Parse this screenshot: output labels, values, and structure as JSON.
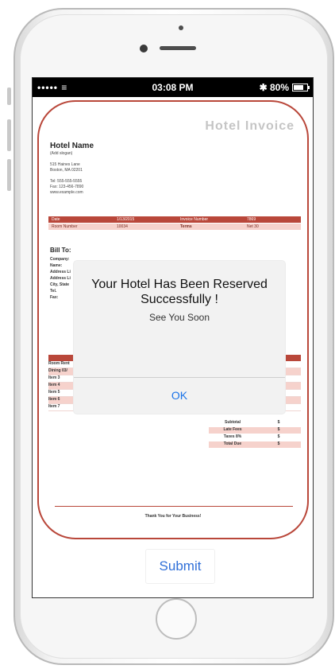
{
  "status_bar": {
    "signal": "••••• ≡",
    "time": "03:08 PM",
    "battery_text": "✱ 80%"
  },
  "invoice": {
    "title": "Hotel Invoice",
    "hotel_name": "Hotel Name",
    "slogan": "(Add slogan)",
    "address_line1": "515 Haines Lane",
    "address_line2": "Boston, MA 02201",
    "tel": "Tel: 555-555-5555",
    "fax": "Fax: 123-456-7890",
    "web": "www.example.com",
    "band1": {
      "date_label": "Date",
      "date_value": "1/13/2015",
      "invoice_label": "Invoice Number",
      "invoice_value": "7869"
    },
    "band2": {
      "room_label": "Room Number",
      "room_value": "10034",
      "terms_label": "Terms",
      "terms_value": "Net 30"
    },
    "bill_to": "Bill To:",
    "bill_lines": [
      "Company:",
      "Name:",
      "Address Li",
      "Address Li",
      "City, State",
      "Tel.",
      "Fax:"
    ],
    "item_rows": [
      "Room Rent",
      "Dining 03/",
      "Item 3",
      "Item 4",
      "Item 5",
      "Item 6",
      "Item 7"
    ],
    "totals": [
      {
        "label": "Subtotal",
        "value": "$"
      },
      {
        "label": "Late Fees",
        "value": "$"
      },
      {
        "label": "Taxes 8%",
        "value": "$"
      },
      {
        "label": "Total Due",
        "value": "$"
      }
    ],
    "thanks": "Thank You for Your Business!"
  },
  "dialog": {
    "title": "Your Hotel Has Been Reserved Successfully !",
    "message": "See You Soon",
    "ok_label": "OK"
  },
  "submit_label": "Submit",
  "colors": {
    "accent": "#b9473a",
    "link": "#1a73e8",
    "band_light": "#f6d2cc"
  },
  "icons": [
    "wifi-icon",
    "bluetooth-icon",
    "battery-icon",
    "home-button"
  ]
}
